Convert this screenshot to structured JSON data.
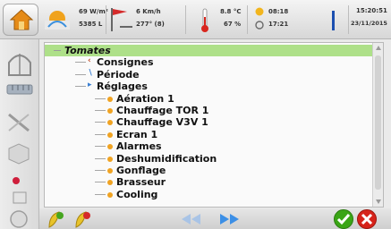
{
  "weather": {
    "radiation": "69 W/m²",
    "radiation_sum": "5385 L",
    "wind_speed": "6 Km/h",
    "wind_dir": "277° (8)",
    "temperature": "8.8 °C",
    "humidity": "67 %",
    "sunrise": "08:18",
    "sunset": "17:21",
    "time": "15:20:51",
    "date": "23/11/2015"
  },
  "tree": {
    "items": [
      {
        "label": "Tomates",
        "italic": true,
        "selected": true
      },
      {
        "label": "Consignes"
      },
      {
        "label": "Période"
      },
      {
        "label": "Réglages"
      },
      {
        "label": "Aération 1"
      },
      {
        "label": "Chauffage TOR 1"
      },
      {
        "label": "Chauffage V3V 1"
      },
      {
        "label": "Ecran 1"
      },
      {
        "label": "Alarmes"
      },
      {
        "label": "Deshumidification"
      },
      {
        "label": "Gonflage"
      },
      {
        "label": "Brasseur"
      },
      {
        "label": "Cooling"
      }
    ]
  },
  "icons": {
    "home": "home-icon",
    "ok": "check-icon",
    "cancel": "close-icon",
    "back": "double-arrow-left-icon",
    "forward": "double-arrow-right-icon"
  },
  "colors": {
    "selection": "#aee089",
    "ok": "#3aa516",
    "cancel": "#d6231a",
    "nav": "#3c8fe6"
  }
}
